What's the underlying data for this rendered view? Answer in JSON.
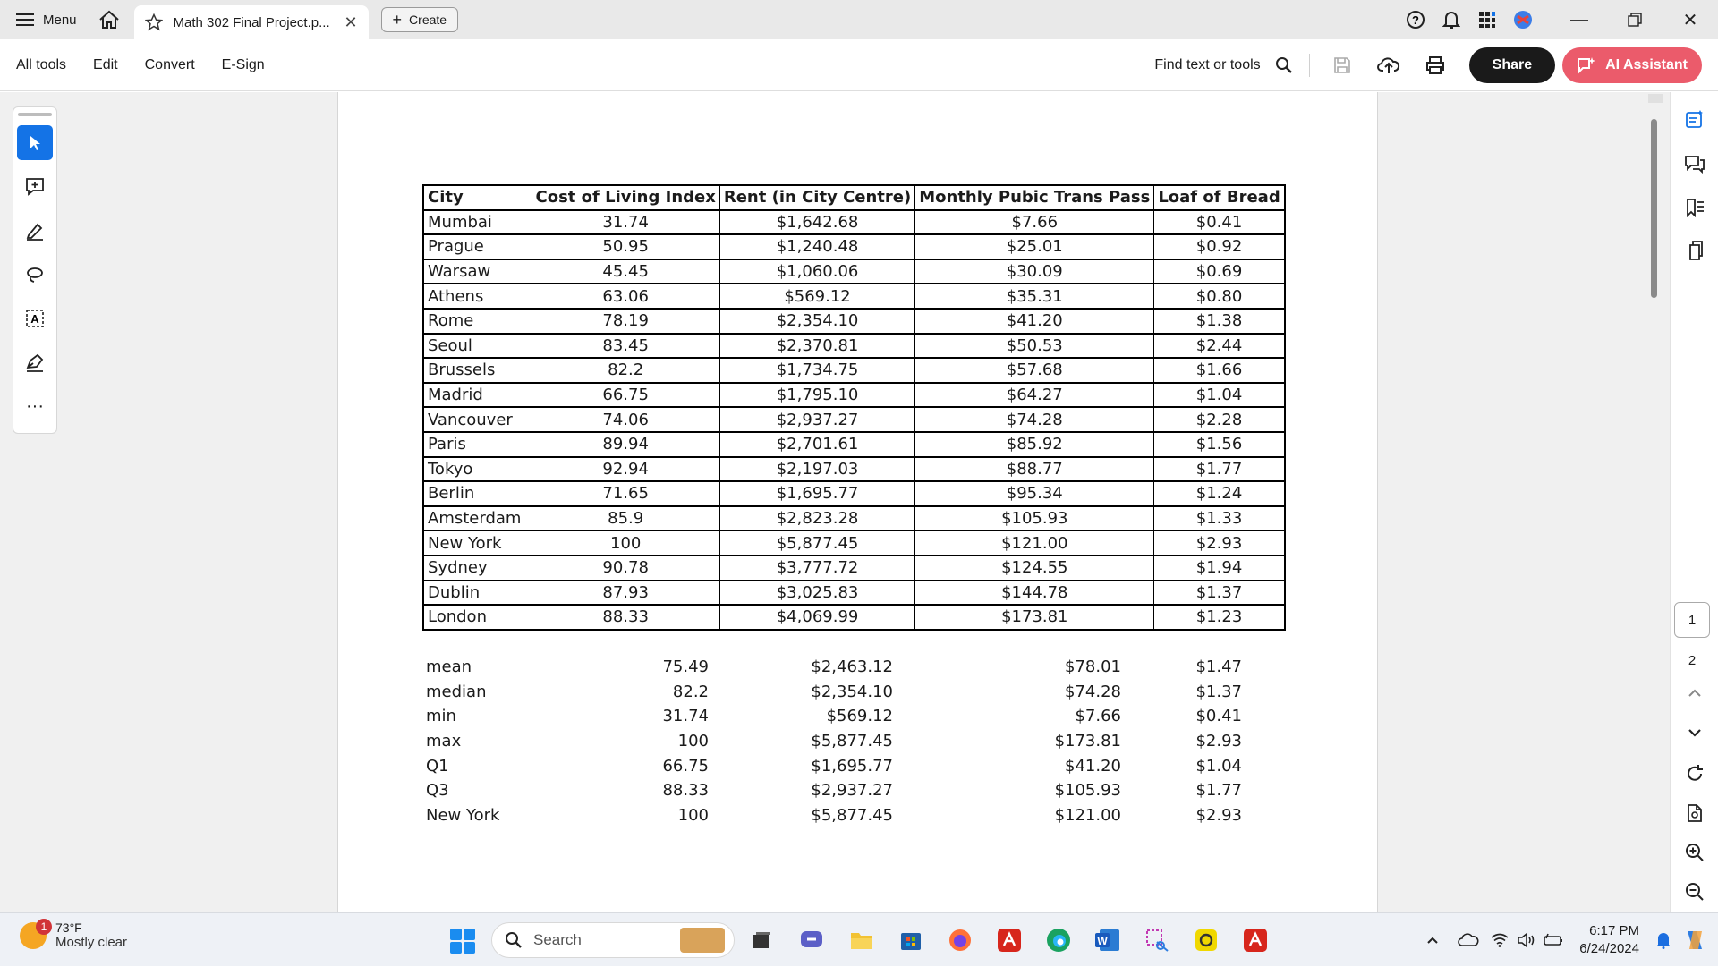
{
  "titlebar": {
    "menu_label": "Menu",
    "tab_title": "Math 302 Final Project.p...",
    "create_label": "Create"
  },
  "toolbar": {
    "menu": [
      "All tools",
      "Edit",
      "Convert",
      "E-Sign"
    ],
    "find_label": "Find text or tools",
    "share_label": "Share",
    "ai_label": "AI Assistant"
  },
  "table": {
    "headers": [
      "City",
      "Cost of Living Index",
      "Rent (in City Centre)",
      "Monthly Pubic Trans Pass",
      "Loaf of Bread"
    ],
    "rows": [
      [
        "Mumbai",
        "31.74",
        "$1,642.68",
        "$7.66",
        "$0.41"
      ],
      [
        "Prague",
        "50.95",
        "$1,240.48",
        "$25.01",
        "$0.92"
      ],
      [
        "Warsaw",
        "45.45",
        "$1,060.06",
        "$30.09",
        "$0.69"
      ],
      [
        "Athens",
        "63.06",
        "$569.12",
        "$35.31",
        "$0.80"
      ],
      [
        "Rome",
        "78.19",
        "$2,354.10",
        "$41.20",
        "$1.38"
      ],
      [
        "Seoul",
        "83.45",
        "$2,370.81",
        "$50.53",
        "$2.44"
      ],
      [
        "Brussels",
        "82.2",
        "$1,734.75",
        "$57.68",
        "$1.66"
      ],
      [
        "Madrid",
        "66.75",
        "$1,795.10",
        "$64.27",
        "$1.04"
      ],
      [
        "Vancouver",
        "74.06",
        "$2,937.27",
        "$74.28",
        "$2.28"
      ],
      [
        "Paris",
        "89.94",
        "$2,701.61",
        "$85.92",
        "$1.56"
      ],
      [
        "Tokyo",
        "92.94",
        "$2,197.03",
        "$88.77",
        "$1.77"
      ],
      [
        "Berlin",
        "71.65",
        "$1,695.77",
        "$95.34",
        "$1.24"
      ],
      [
        "Amsterdam",
        "85.9",
        "$2,823.28",
        "$105.93",
        "$1.33"
      ],
      [
        "New York",
        "100",
        "$5,877.45",
        "$121.00",
        "$2.93"
      ],
      [
        "Sydney",
        "90.78",
        "$3,777.72",
        "$124.55",
        "$1.94"
      ],
      [
        "Dublin",
        "87.93",
        "$3,025.83",
        "$144.78",
        "$1.37"
      ],
      [
        "London",
        "88.33",
        "$4,069.99",
        "$173.81",
        "$1.23"
      ]
    ]
  },
  "stats": [
    [
      "mean",
      "75.49",
      "$2,463.12",
      "$78.01",
      "$1.47"
    ],
    [
      "median",
      "82.2",
      "$2,354.10",
      "$74.28",
      "$1.37"
    ],
    [
      "min",
      "31.74",
      "$569.12",
      "$7.66",
      "$0.41"
    ],
    [
      "max",
      "100",
      "$5,877.45",
      "$173.81",
      "$2.93"
    ],
    [
      "Q1",
      "66.75",
      "$1,695.77",
      "$41.20",
      "$1.04"
    ],
    [
      "Q3",
      "88.33",
      "$2,937.27",
      "$105.93",
      "$1.77"
    ],
    [
      "New York",
      "100",
      "$5,877.45",
      "$121.00",
      "$2.93"
    ]
  ],
  "pages": {
    "current": "1",
    "next": "2"
  },
  "taskbar": {
    "weather_badge": "1",
    "temperature": "73°F",
    "condition": "Mostly clear",
    "search_placeholder": "Search",
    "time": "6:17 PM",
    "date": "6/24/2024"
  },
  "colors": {
    "accent": "#1473e6",
    "ai": "#eb5b6b",
    "share": "#1a1a1a"
  }
}
